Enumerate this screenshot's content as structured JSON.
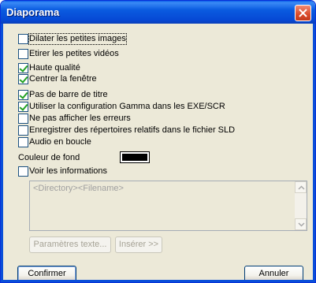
{
  "window": {
    "title": "Diaporama"
  },
  "options": [
    {
      "label": "Dilater les petites images",
      "checked": false
    },
    {
      "label": "Etirer les petites vidéos",
      "checked": false
    },
    {
      "label": "Haute qualité",
      "checked": true
    },
    {
      "label": "Centrer la fenêtre",
      "checked": true
    },
    {
      "label": "Pas de barre de titre",
      "checked": true
    },
    {
      "label": "Utiliser la configuration Gamma dans les EXE/SCR",
      "checked": true
    },
    {
      "label": "Ne pas afficher les erreurs",
      "checked": false
    },
    {
      "label": "Enregistrer des répertoires relatifs dans le fichier SLD",
      "checked": false
    },
    {
      "label": "Audio en boucle",
      "checked": false
    }
  ],
  "background": {
    "label": "Couleur de fond",
    "color": "#000000"
  },
  "info": {
    "label": "Voir les informations",
    "checked": false,
    "text_value": "<Directory><Filename>",
    "text_settings_button": "Paramètres texte...",
    "insert_button": "Insérer >>"
  },
  "footer": {
    "confirm": "Confirmer",
    "cancel": "Annuler"
  }
}
